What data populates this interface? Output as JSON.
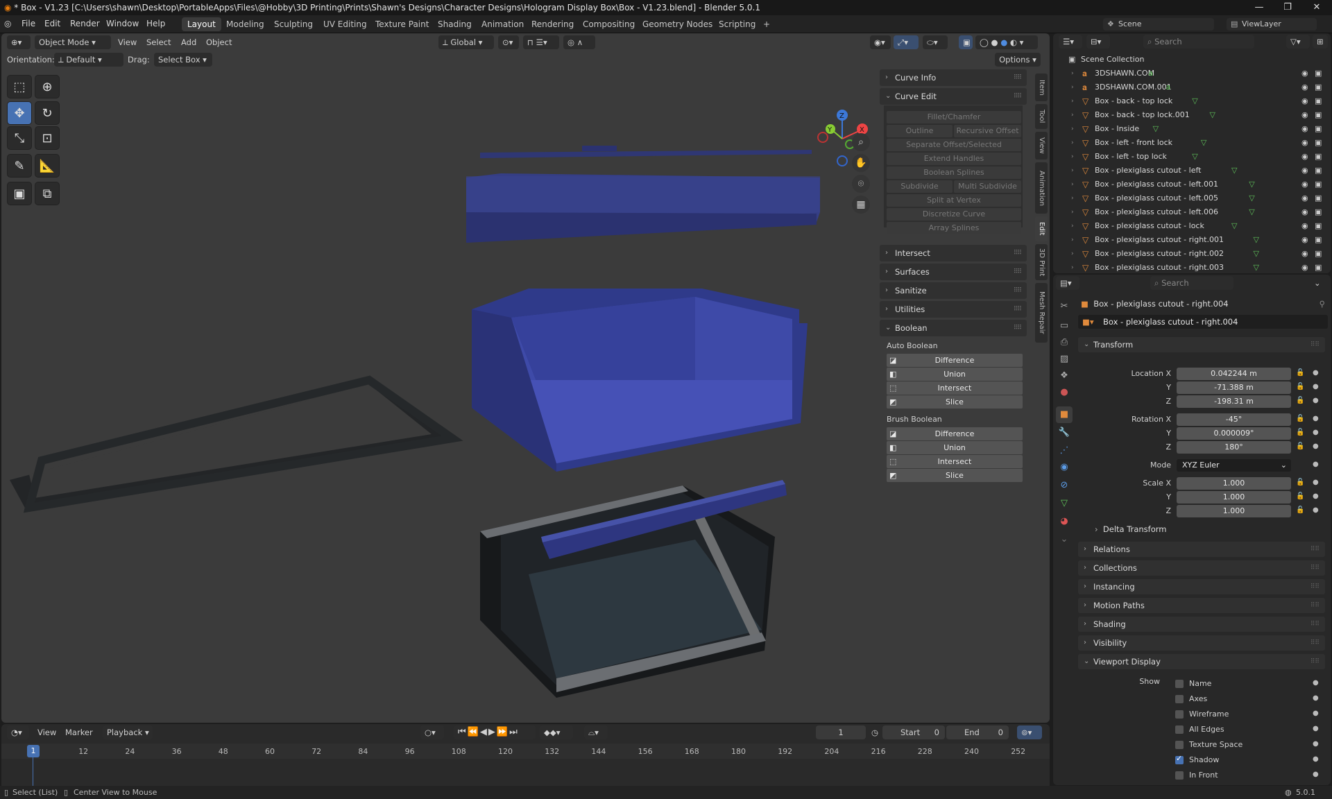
{
  "title": "* Box - V1.23 [C:\\Users\\shawn\\Desktop\\PortableApps\\Files\\@Hobby\\3D Printing\\Prints\\Shawn's Designs\\Character Designs\\Hologram Display Box\\Box - V1.23.blend] - Blender 5.0.1",
  "menu": [
    "File",
    "Edit",
    "Render",
    "Window",
    "Help"
  ],
  "workspaces": [
    "Layout",
    "Modeling",
    "Sculpting",
    "UV Editing",
    "Texture Paint",
    "Shading",
    "Animation",
    "Rendering",
    "Compositing",
    "Geometry Nodes",
    "Scripting",
    "+"
  ],
  "scene": {
    "scene_label": "Scene",
    "viewlayer_label": "ViewLayer",
    "search_placeholder": "Search"
  },
  "viewport": {
    "mode": "Object Mode",
    "menus": [
      "View",
      "Select",
      "Add",
      "Object"
    ],
    "transform": "Global",
    "orientation_label": "Orientation:",
    "orientation_value": "Default",
    "drag_label": "Drag:",
    "drag_value": "Select Box",
    "options": "Options",
    "gizmo": {
      "x": "X",
      "y": "Y",
      "z": "Z"
    }
  },
  "npanel": {
    "curve_info": "Curve Info",
    "curve_edit": "Curve Edit",
    "curve_buttons": {
      "fillet": "Fillet/Chamfer",
      "outline": "Outline",
      "recursive": "Recursive Offset",
      "separate": "Separate Offset/Selected",
      "extend": "Extend Handles",
      "boolean_splines": "Boolean Splines",
      "subdivide": "Subdivide",
      "multi": "Multi Subdivide",
      "split": "Split at Vertex",
      "discretize": "Discretize Curve",
      "array": "Array Splines"
    },
    "intersect": "Intersect",
    "surfaces": "Surfaces",
    "sanitize": "Sanitize",
    "utilities": "Utilities",
    "boolean": "Boolean",
    "auto_boolean": "Auto Boolean",
    "brush_boolean": "Brush Boolean",
    "ops": [
      "Difference",
      "Union",
      "Intersect",
      "Slice"
    ],
    "tabs": [
      "Item",
      "Tool",
      "View",
      "Animation",
      "Edit",
      "3D Print",
      "Mesh Repair"
    ]
  },
  "timeline": {
    "menus": [
      "View",
      "Marker",
      "Playback"
    ],
    "current_frame": "1",
    "start_label": "Start",
    "start": "0",
    "end_label": "End",
    "end": "0",
    "ticks": [
      "1",
      "12",
      "24",
      "36",
      "48",
      "60",
      "72",
      "84",
      "96",
      "108",
      "120",
      "132",
      "144",
      "156",
      "168",
      "180",
      "192",
      "204",
      "216",
      "228",
      "240",
      "252"
    ]
  },
  "status": {
    "left": "Select (List)",
    "mid": "Center View to Mouse",
    "version": "5.0.1"
  },
  "outliner": {
    "root": "Scene Collection",
    "items": [
      "3DSHAWN.COM",
      "3DSHAWN.COM.001",
      "Box - back - top lock",
      "Box - back - top lock.001",
      "Box - Inside",
      "Box - left - front lock",
      "Box - left - top lock",
      "Box - plexiglass cutout - left",
      "Box - plexiglass cutout - left.001",
      "Box - plexiglass cutout - left.005",
      "Box - plexiglass cutout - left.006",
      "Box - plexiglass cutout - lock",
      "Box - plexiglass cutout - right.001",
      "Box - plexiglass cutout - right.002",
      "Box - plexiglass cutout - right.003"
    ]
  },
  "properties": {
    "object_name": "Box - plexiglass cutout - right.004",
    "data_name": "Box - plexiglass cutout - right.004",
    "search_placeholder": "Search",
    "transform": "Transform",
    "loc_label": "Location X",
    "y": "Y",
    "z": "Z",
    "loc_x": "0.042244 m",
    "loc_y": "-71.388 m",
    "loc_z": "-198.31 m",
    "rot_label": "Rotation X",
    "rot_x": "-45°",
    "rot_y": "0.000009°",
    "rot_z": "180°",
    "mode_label": "Mode",
    "mode": "XYZ Euler",
    "scale_label": "Scale X",
    "scale_x": "1.000",
    "scale_y": "1.000",
    "scale_z": "1.000",
    "delta": "Delta Transform",
    "sections": [
      "Relations",
      "Collections",
      "Instancing",
      "Motion Paths",
      "Shading",
      "Visibility"
    ],
    "viewport_display": "Viewport Display",
    "show_label": "Show",
    "show": [
      {
        "label": "Name",
        "on": false
      },
      {
        "label": "Axes",
        "on": false
      },
      {
        "label": "Wireframe",
        "on": false
      },
      {
        "label": "All Edges",
        "on": false
      },
      {
        "label": "Texture Space",
        "on": false
      },
      {
        "label": "Shadow",
        "on": true
      },
      {
        "label": "In Front",
        "on": false
      }
    ]
  }
}
